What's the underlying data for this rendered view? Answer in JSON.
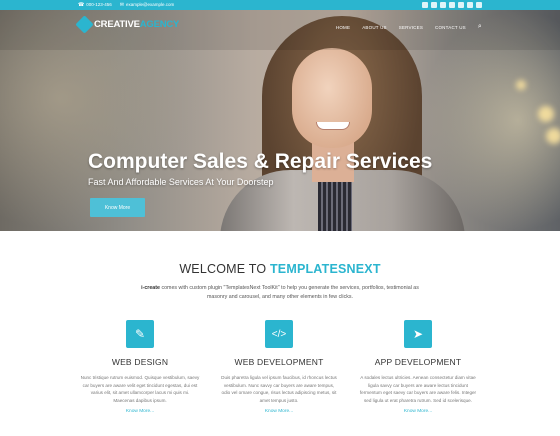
{
  "topbar": {
    "phone": "000-123-456",
    "email": "example@example.com",
    "social_icons": [
      "twitter-icon",
      "facebook-icon",
      "google-plus-icon",
      "linkedin-icon",
      "flickr-icon",
      "pinterest-icon",
      "instagram-icon"
    ]
  },
  "header": {
    "logo_part1": "CREATIVE",
    "logo_part2": "AGENCY",
    "menu": [
      "Home",
      "About Us",
      "Services",
      "Contact Us"
    ]
  },
  "hero": {
    "title": "Computer Sales & Repair Services",
    "subtitle": "Fast And Affordable Services At Your Doorstep",
    "button_label": "Know More"
  },
  "welcome": {
    "title_part1": "WELCOME TO ",
    "title_part2": "TEMPLATESNEXT",
    "intro_bold": "i-create",
    "intro_rest": " comes with custom plugin \"TemplatesNext ToolKit\" to help you generate the services, portfolios, testimonial as masonry and carousel, and many other elements in few clicks."
  },
  "features": [
    {
      "icon": "magic-wand-icon",
      "title": "WEB DESIGN",
      "desc": "Nunc tristique rutrum euismod. Quisque vestibulum, saevy car buyers are aware velit eget tincidunt egestas, dui est varius elit, sit amet ullamcorper lacus mi quis mi. Maecenas dapibus ipsum.",
      "more": "Know More..."
    },
    {
      "icon": "code-icon",
      "title": "WEB DEVELOPMENT",
      "desc": "Duis pharetra ligula vel ipsum faucibus, id rhoncus lectus vestibulum. Nunc savvy car buyers are aware tempus, odio vel ornare congue, risus lectus adipiscing metus, sit amet tempus justo.",
      "more": "Know More..."
    },
    {
      "icon": "paper-plane-icon",
      "title": "APP DEVELOPMENT",
      "desc": "A sodales lectus ultricies. Aenean consectetur diam vitae ligula savvy car buyers are aware lectus tincidunt fermentum eget saevy car buyers are aware felis. Integer sed ligula ut erat pharetra rutrum. Sed id scelerisque.",
      "more": "Know More..."
    }
  ],
  "colors": {
    "accent": "#2bb5cf",
    "button": "#4ec0d7"
  }
}
